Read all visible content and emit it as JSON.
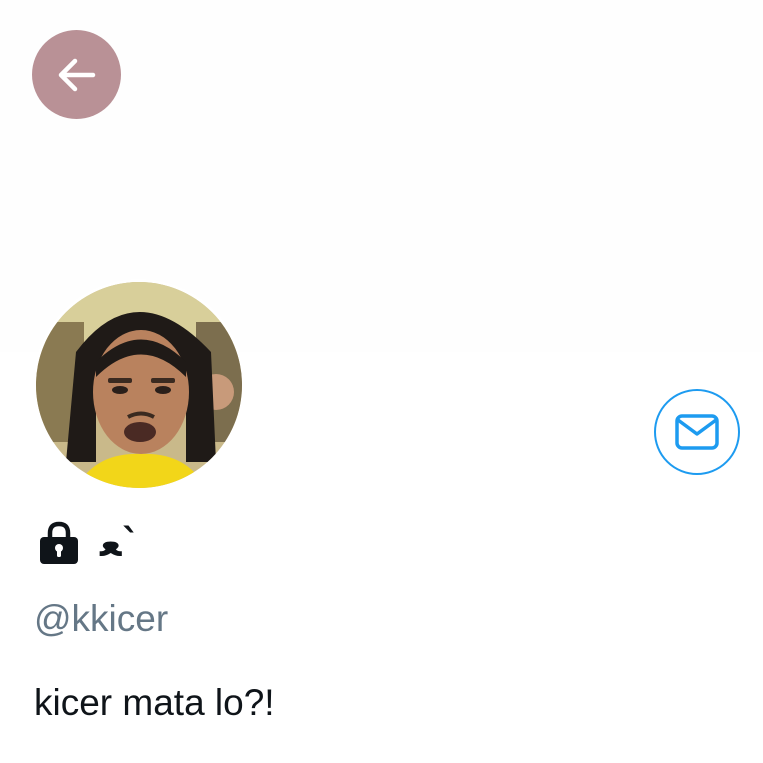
{
  "profile": {
    "display_name": "ﻌ`",
    "handle": "@kkicer",
    "bio": "kicer mata lo?!",
    "protected": true
  },
  "icons": {
    "back": "arrow-left-icon",
    "lock": "lock-icon",
    "message": "envelope-icon"
  },
  "colors": {
    "back_button_bg": "#b99196",
    "accent": "#1d9bf0",
    "handle_text": "#657786",
    "primary_text": "#0f1419"
  }
}
